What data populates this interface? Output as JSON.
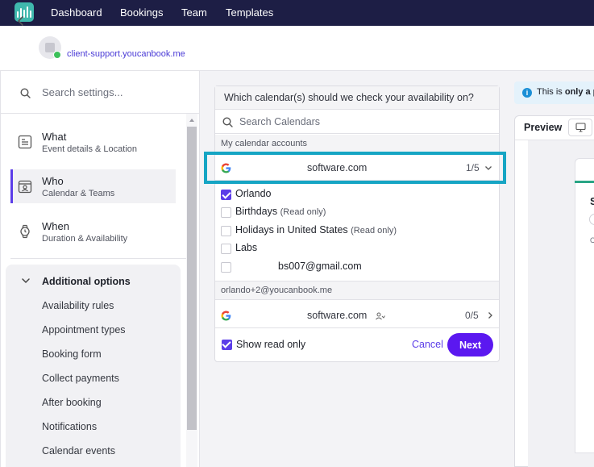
{
  "topnav": {
    "items": [
      "Dashboard",
      "Bookings",
      "Team",
      "Templates"
    ]
  },
  "header": {
    "page_url": "client-support.youcanbook.me"
  },
  "settings": {
    "search_placeholder": "Search settings...",
    "menu": [
      {
        "title": "What",
        "subtitle": "Event details & Location",
        "icon": "document-icon"
      },
      {
        "title": "Who",
        "subtitle": "Calendar & Teams",
        "icon": "calendar-person-icon"
      },
      {
        "title": "When",
        "subtitle": "Duration & Availability",
        "icon": "watch-icon"
      }
    ],
    "additional": {
      "title": "Additional options",
      "items": [
        "Availability rules",
        "Appointment types",
        "Booking form",
        "Collect payments",
        "After booking",
        "Notifications",
        "Calendar events"
      ]
    }
  },
  "calendar_picker": {
    "question": "Which calendar(s) should we check your availability on?",
    "search_placeholder": "Search Calendars",
    "group1_label": "My calendar accounts",
    "account1": {
      "name": "software.com",
      "count": "1/5"
    },
    "calendars": [
      {
        "label": "Orlando",
        "read_only": "",
        "checked": true
      },
      {
        "label": "Birthdays",
        "read_only": "(Read only)",
        "checked": false
      },
      {
        "label": "Holidays in United States",
        "read_only": "(Read only)",
        "checked": false
      },
      {
        "label": "Labs",
        "read_only": "",
        "checked": false
      },
      {
        "label": "bs007@gmail.com",
        "read_only": "",
        "checked": false
      }
    ],
    "group2_label": "orlando+2@youcanbook.me",
    "account2": {
      "name": "software.com",
      "count": "0/5"
    },
    "show_read_only": "Show read only",
    "cancel_label": "Cancel",
    "next_label": "Next"
  },
  "preview": {
    "banner_prefix": "This is",
    "banner_bold": "only a p",
    "tab_label": "Preview",
    "heading_letter": "S",
    "sub_letter": "C"
  },
  "colors": {
    "nav_bg": "#1d1e45",
    "accent": "#5b3de8",
    "next_button": "#5b18f0",
    "highlight": "#16a5c4",
    "status_online": "#3cc05a"
  }
}
